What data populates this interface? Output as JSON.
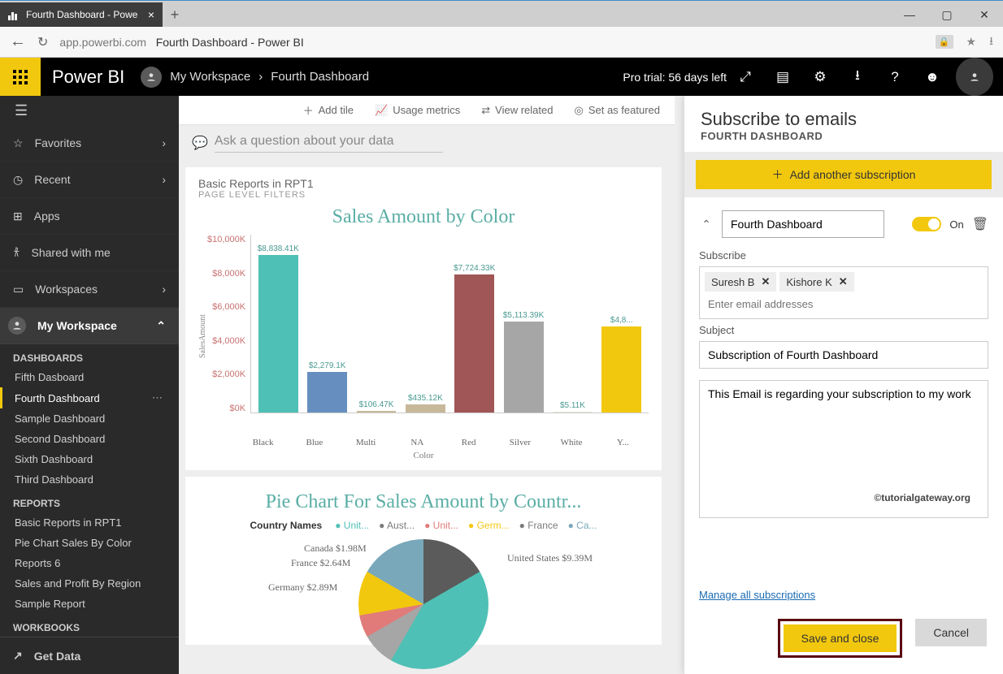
{
  "browser": {
    "tab_title": "Fourth Dashboard - Powe",
    "url_host": "app.powerbi.com",
    "url_title": "Fourth Dashboard - Power BI"
  },
  "appbar": {
    "brand": "Power BI",
    "crumb1": "My Workspace",
    "crumb2": "Fourth Dashboard",
    "pro_trial": "Pro trial: 56 days left"
  },
  "sidebar": {
    "favorites": "Favorites",
    "recent": "Recent",
    "apps": "Apps",
    "shared": "Shared with me",
    "workspaces": "Workspaces",
    "myworkspace": "My Workspace",
    "dashboards_header": "DASHBOARDS",
    "dashboards": [
      "Fifth Dasboard",
      "Fourth Dashboard",
      "Sample Dashboard",
      "Second Dashboard",
      "Sixth Dashboard",
      "Third Dashboard"
    ],
    "reports_header": "REPORTS",
    "reports": [
      "Basic Reports in RPT1",
      "Pie Chart Sales By Color",
      "Reports 6",
      "Sales and Profit By Region",
      "Sample Report"
    ],
    "workbooks_header": "WORKBOOKS",
    "getdata": "Get Data"
  },
  "toolbar": {
    "add_tile": "Add tile",
    "usage": "Usage metrics",
    "related": "View related",
    "featured": "Set as featured"
  },
  "qna_placeholder": "Ask a question about your data",
  "card1": {
    "title": "Basic Reports in RPT1",
    "sub": "PAGE LEVEL FILTERS"
  },
  "card2": {
    "title": "Pie Chart For Sales Amount by Countr...",
    "legend_label": "Country Names"
  },
  "pie_legend": [
    "Unit...",
    "Aust...",
    "Unit...",
    "Germ...",
    "France",
    "Ca..."
  ],
  "pie_labels": {
    "canada": "Canada $1.98M",
    "france": "France $2.64M",
    "germany": "Germany $2.89M",
    "us": "United States $9.39M"
  },
  "panel": {
    "title": "Subscribe to emails",
    "sub": "FOURTH DASHBOARD",
    "add_btn": "Add another subscription",
    "name_value": "Fourth Dashboard",
    "on_text": "On",
    "subscribe_label": "Subscribe",
    "chip1": "Suresh B",
    "chip2": "Kishore K",
    "email_placeholder": "Enter email addresses",
    "subject_label": "Subject",
    "subject_value": "Subscription of Fourth Dashboard",
    "body_value": "This Email is regarding your subscription to my work",
    "manage": "Manage all subscriptions",
    "save": "Save and close",
    "cancel": "Cancel",
    "watermark": "©tutorialgateway.org"
  },
  "chart_data": {
    "type": "bar",
    "title": "Sales Amount by Color",
    "xlabel": "Color",
    "ylabel": "SalesAmount",
    "ylim": [
      0,
      10000
    ],
    "yticks": [
      "$10,000K",
      "$8,000K",
      "$6,000K",
      "$4,000K",
      "$2,000K",
      "$0K"
    ],
    "categories": [
      "Black",
      "Blue",
      "Multi",
      "NA",
      "Red",
      "Silver",
      "White",
      "Y..."
    ],
    "values": [
      8838.41,
      2279.1,
      106.47,
      435.12,
      7724.33,
      5113.39,
      5.11,
      4800
    ],
    "labels": [
      "$8,838.41K",
      "$2,279.1K",
      "$106.47K",
      "$435.12K",
      "$7,724.33K",
      "$5,113.39K",
      "$5.11K",
      "$4,8..."
    ],
    "colors": [
      "#4fc0b5",
      "#668fbf",
      "#c8b89a",
      "#c8b89a",
      "#a05656",
      "#a6a6a6",
      "#e8e3cf",
      "#f2c80f"
    ]
  }
}
